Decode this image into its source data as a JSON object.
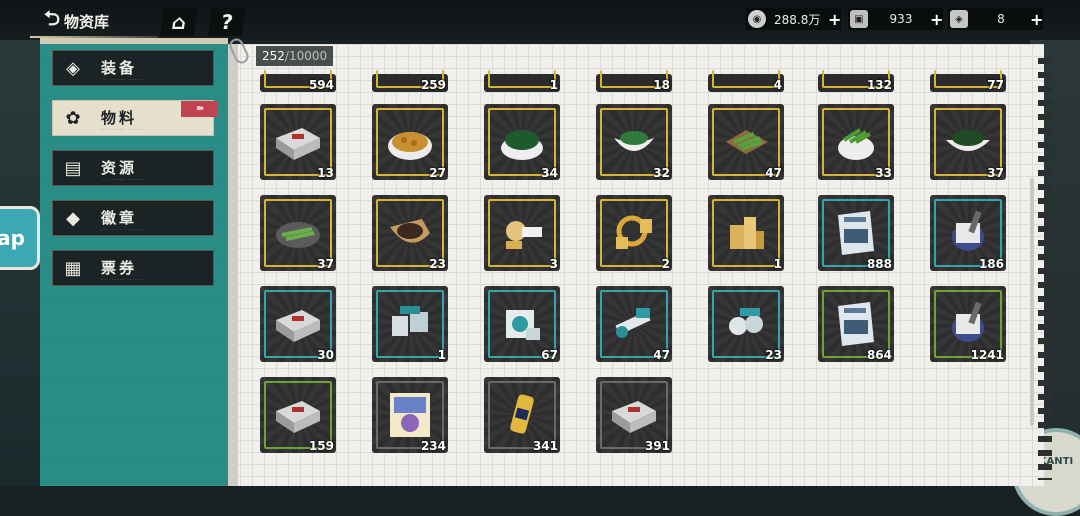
{
  "header": {
    "title": "物资库",
    "home_glyph": "⌂",
    "help_glyph": "?"
  },
  "currencies": [
    {
      "icon": "coin-icon",
      "value": "288.8万",
      "plus": "+"
    },
    {
      "icon": "ticket-icon",
      "value": "933",
      "plus": "+"
    },
    {
      "icon": "gem-icon",
      "value": "8",
      "plus": "+"
    }
  ],
  "sidebar": {
    "items": [
      {
        "label": "装备",
        "icon": "equipment-icon",
        "glyph": "◈",
        "active": false
      },
      {
        "label": "物料",
        "icon": "materials-icon",
        "glyph": "✿",
        "active": true
      },
      {
        "label": "资源",
        "icon": "resources-icon",
        "glyph": "▤",
        "active": false
      },
      {
        "label": "徽章",
        "icon": "badge-icon",
        "glyph": "◆",
        "active": false
      },
      {
        "label": "票券",
        "icon": "tickets-icon",
        "glyph": "▦",
        "active": false
      }
    ],
    "active_chevron": "›››"
  },
  "inventory": {
    "count": "252",
    "capacity": "/10000",
    "top_row": [
      "594",
      "259",
      "1",
      "18",
      "4",
      "132",
      "77"
    ],
    "rows": [
      [
        {
          "qty": "13",
          "rarity": "gold",
          "icon": "gray-box-icon"
        },
        {
          "qty": "27",
          "rarity": "gold",
          "icon": "bean-bowl-icon"
        },
        {
          "qty": "34",
          "rarity": "gold",
          "icon": "seaweed-bowl-icon"
        },
        {
          "qty": "32",
          "rarity": "gold",
          "icon": "vegetable-dish-icon"
        },
        {
          "qty": "47",
          "rarity": "gold",
          "icon": "green-beans-tray-icon"
        },
        {
          "qty": "33",
          "rarity": "gold",
          "icon": "green-beans-bowl-icon"
        },
        {
          "qty": "37",
          "rarity": "gold",
          "icon": "greens-dish-icon"
        }
      ],
      [
        {
          "qty": "37",
          "rarity": "gold",
          "icon": "green-beans-plate-icon"
        },
        {
          "qty": "23",
          "rarity": "gold",
          "icon": "tea-scoop-icon"
        },
        {
          "qty": "3",
          "rarity": "gold",
          "icon": "golden-parts-icon"
        },
        {
          "qty": "2",
          "rarity": "gold",
          "icon": "golden-gears-icon"
        },
        {
          "qty": "1",
          "rarity": "gold",
          "icon": "golden-blocks-icon"
        },
        {
          "qty": "888",
          "rarity": "teal",
          "icon": "book-icon"
        },
        {
          "qty": "186",
          "rarity": "teal",
          "icon": "paint-can-icon"
        }
      ],
      [
        {
          "qty": "30",
          "rarity": "teal",
          "icon": "gray-box-icon"
        },
        {
          "qty": "1",
          "rarity": "teal",
          "icon": "teal-parts-icon"
        },
        {
          "qty": "67",
          "rarity": "teal",
          "icon": "teal-device-icon"
        },
        {
          "qty": "47",
          "rarity": "teal",
          "icon": "teal-tools-icon"
        },
        {
          "qty": "23",
          "rarity": "teal",
          "icon": "teal-gears-icon"
        },
        {
          "qty": "864",
          "rarity": "green",
          "icon": "book-icon"
        },
        {
          "qty": "1241",
          "rarity": "green",
          "icon": "paint-can-icon"
        }
      ],
      [
        {
          "qty": "159",
          "rarity": "green",
          "icon": "gray-box-icon"
        },
        {
          "qty": "234",
          "rarity": "dark",
          "icon": "comic-book-icon"
        },
        {
          "qty": "341",
          "rarity": "dark",
          "icon": "golden-canister-icon"
        },
        {
          "qty": "391",
          "rarity": "dark",
          "icon": "gray-box-icon"
        }
      ]
    ]
  },
  "decor": {
    "sticker_text": "ap",
    "badge_text": "KANTI"
  }
}
